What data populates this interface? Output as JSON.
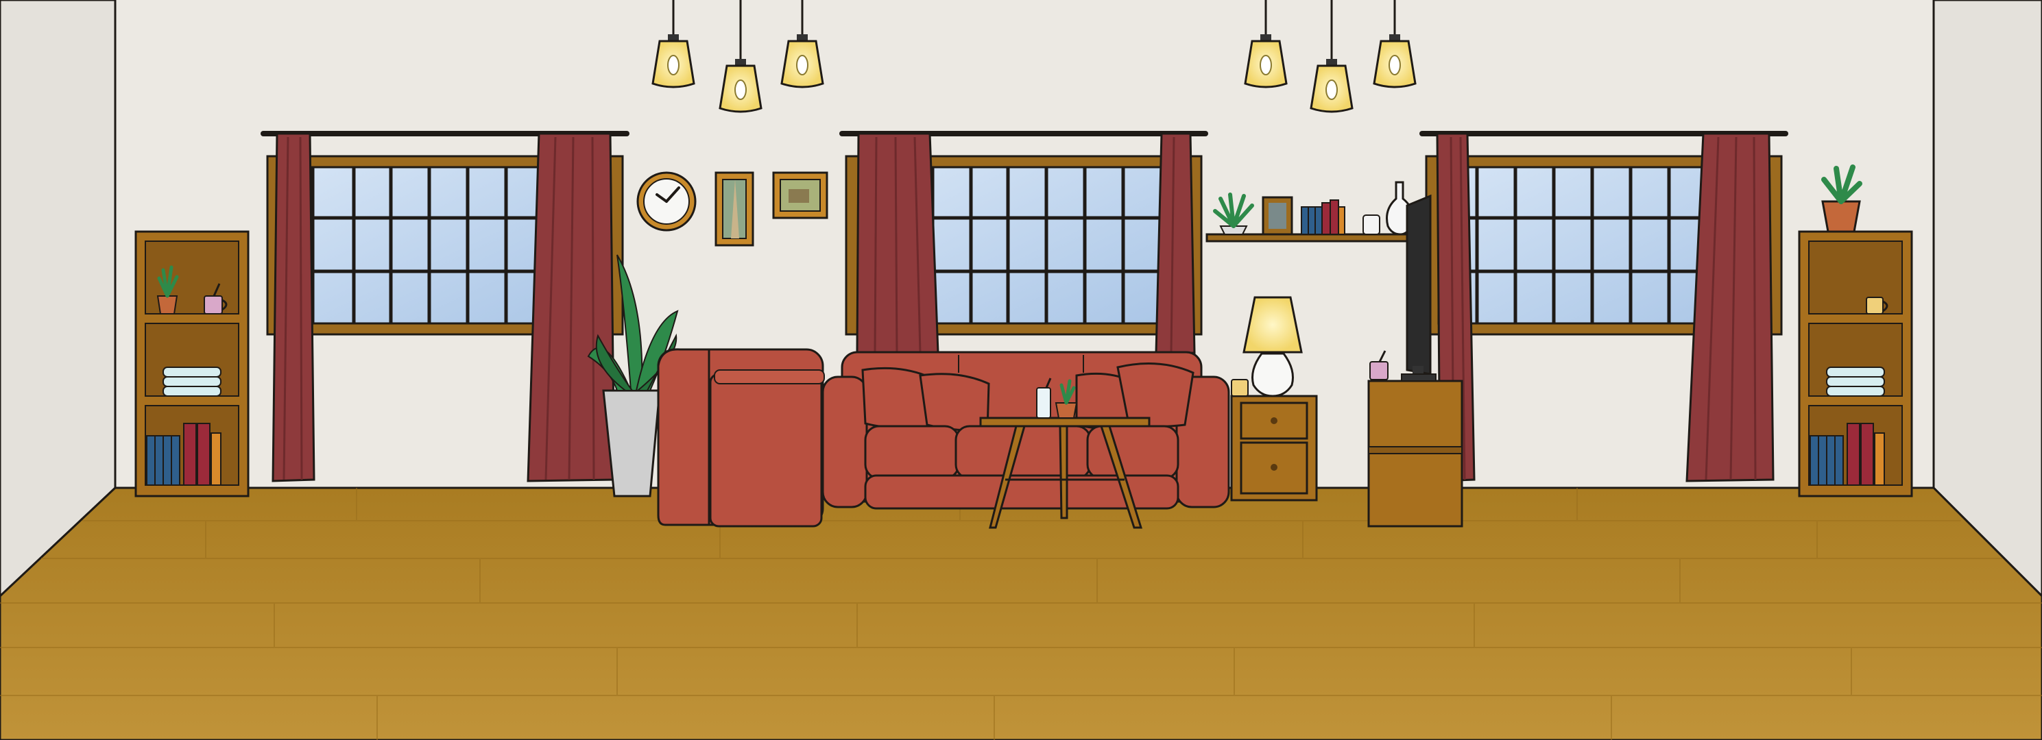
{
  "scene": "living-room",
  "colors": {
    "wall": "#ece9e3",
    "wall_side": "#e2dfd9",
    "floor": "#b8892e",
    "floor_dark": "#a67a25",
    "wood": "#a8701e",
    "wood_dark": "#7a4f14",
    "wood_inner": "#8a5a18",
    "window_glass": "#bcd4ee",
    "window_frame": "#9c6b1f",
    "curtain": "#8e3a3c",
    "curtain_dark": "#6e2a2c",
    "sofa": "#b85040",
    "sofa_dark": "#98402f",
    "lamp_glow": "#fff3b0",
    "book_blue": "#2f5f8c",
    "book_red": "#9c2a3a",
    "book_orange": "#d98a2b",
    "towel": "#d7eef0",
    "plant": "#2e8a4a",
    "pot": "#c4683a",
    "outline": "#1e1a16",
    "tv": "#2b2b2b"
  },
  "icons": [
    "pendant-lamp-icon",
    "wall-clock-icon",
    "picture-frame-icon",
    "table-lamp-icon",
    "plant-icon",
    "tv-icon",
    "vase-icon",
    "mug-icon"
  ]
}
